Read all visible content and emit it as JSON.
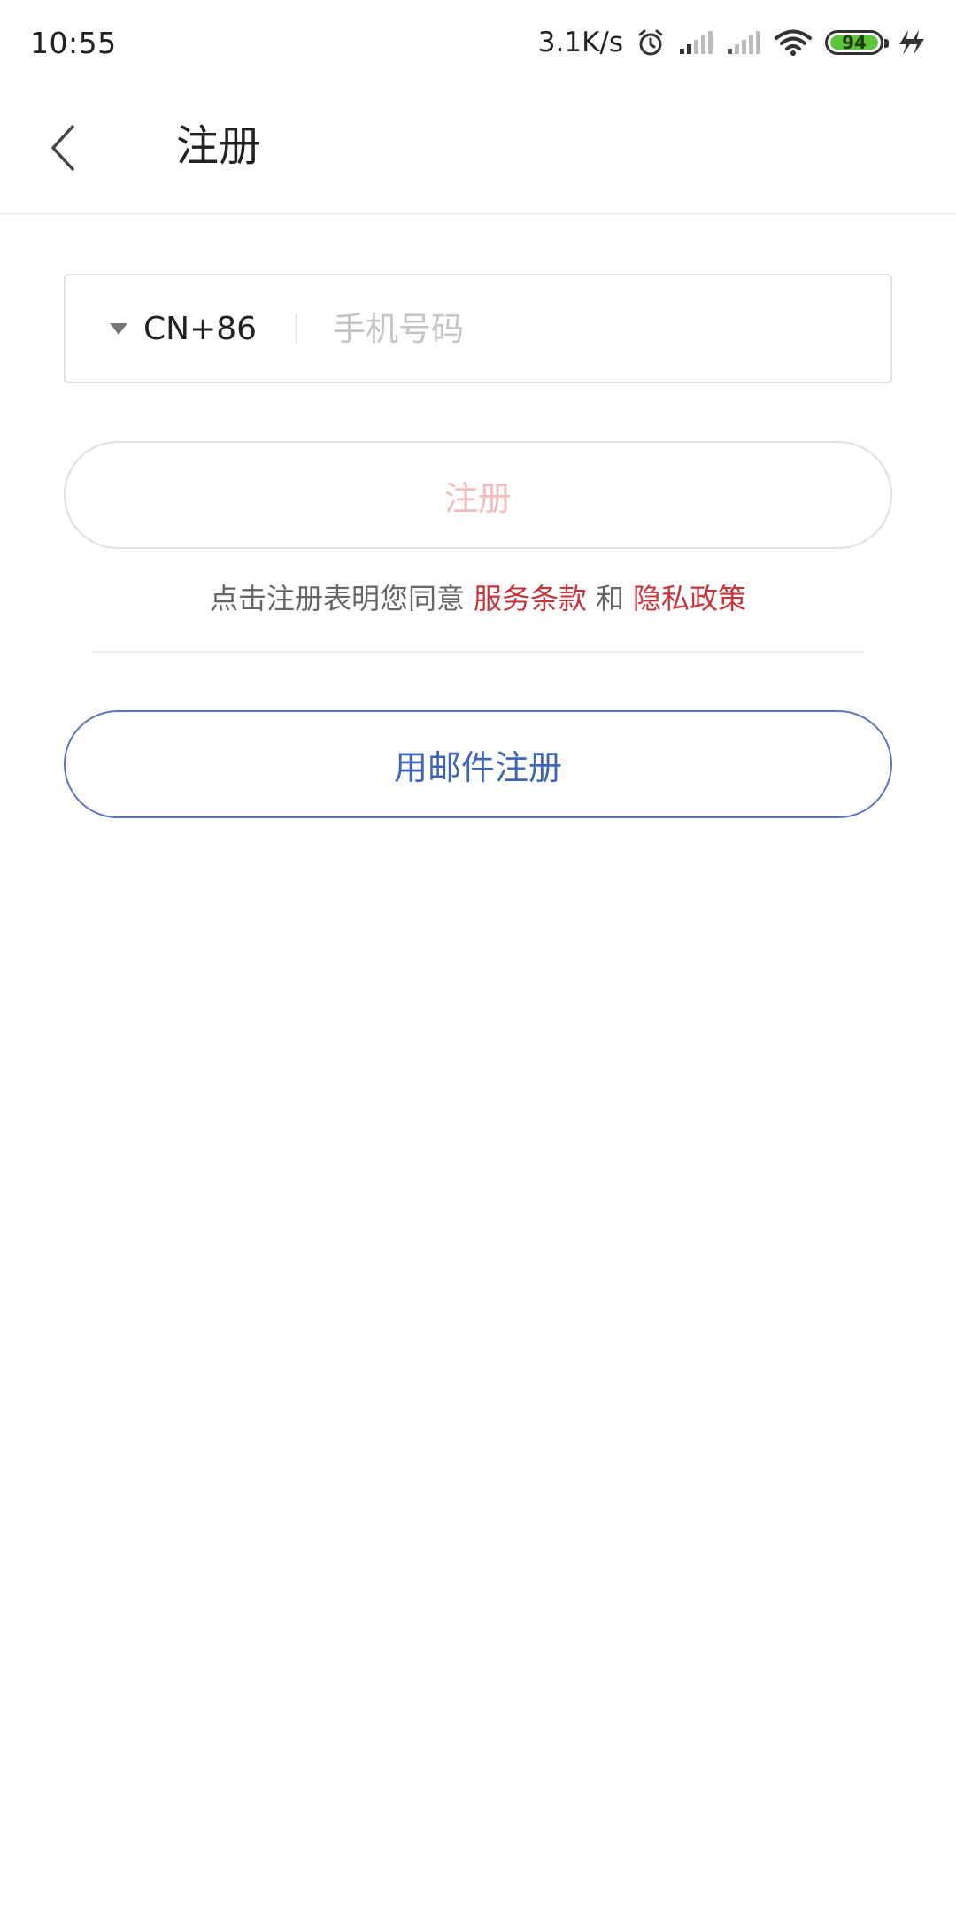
{
  "status_bar": {
    "time": "10:55",
    "net_speed": "3.1K/s",
    "battery_level": "94",
    "icons": [
      "alarm-icon",
      "signal-icon",
      "signal-icon",
      "wifi-icon",
      "battery-icon",
      "charging-icon"
    ]
  },
  "header": {
    "title": "注册",
    "back_icon": "chevron-left-icon"
  },
  "phone_form": {
    "country_code": "CN+86",
    "dropdown_icon": "triangle-down-icon",
    "phone_placeholder": "手机号码",
    "phone_value": ""
  },
  "register_button": {
    "label": "注册"
  },
  "agreement": {
    "prefix": "点击注册表明您同意",
    "terms_link": "服务条款",
    "and_text": "和",
    "privacy_link": "隐私政策"
  },
  "email_register_button": {
    "label": "用邮件注册"
  },
  "colors": {
    "link_red": "#c7343a",
    "disabled_button_text": "#f3bcbc",
    "email_button_blue": "#3f66b6",
    "battery_green": "#5ec43a"
  }
}
